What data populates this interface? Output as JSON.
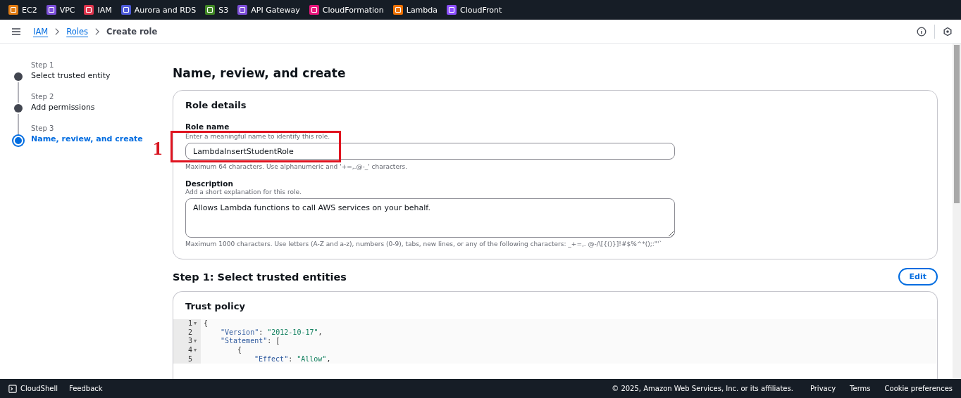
{
  "services": [
    {
      "label": "EC2",
      "color": "#e07b12"
    },
    {
      "label": "VPC",
      "color": "#7b4ed9"
    },
    {
      "label": "IAM",
      "color": "#dd344c"
    },
    {
      "label": "Aurora and RDS",
      "color": "#4d5ad8"
    },
    {
      "label": "S3",
      "color": "#3f8624"
    },
    {
      "label": "API Gateway",
      "color": "#7d4ed9"
    },
    {
      "label": "CloudFormation",
      "color": "#e7157b"
    },
    {
      "label": "Lambda",
      "color": "#ed7100"
    },
    {
      "label": "CloudFront",
      "color": "#8c4fff"
    }
  ],
  "breadcrumbs": [
    {
      "label": "IAM",
      "link": true
    },
    {
      "label": "Roles",
      "link": true
    },
    {
      "label": "Create role",
      "link": false
    }
  ],
  "steps": [
    {
      "step": "Step 1",
      "title": "Select trusted entity",
      "selected": false
    },
    {
      "step": "Step 2",
      "title": "Add permissions",
      "selected": false
    },
    {
      "step": "Step 3",
      "title": "Name, review, and create",
      "selected": true
    }
  ],
  "page_title": "Name, review, and create",
  "role_details": {
    "title": "Role details",
    "role_name": {
      "label": "Role name",
      "hint": "Enter a meaningful name to identify this role.",
      "value": "LambdaInsertStudentRole",
      "constraint": "Maximum 64 characters. Use alphanumeric and '+=,.@-_' characters."
    },
    "description": {
      "label": "Description",
      "hint": "Add a short explanation for this role.",
      "value": "Allows Lambda functions to call AWS services on your behalf.",
      "constraint": "Maximum 1000 characters. Use letters (A-Z and a-z), numbers (0-9), tabs, new lines, or any of the following characters: _+=,. @-/\\[{()}]!#$%^*();:\"'`"
    }
  },
  "annotation": {
    "label": "1"
  },
  "trusted_entities": {
    "title": "Step 1: Select trusted entities",
    "edit_button": "Edit",
    "card_title": "Trust policy",
    "code_lines": [
      {
        "number": "1",
        "fold_marker": "▼",
        "text": "{",
        "children": [
          {
            "number": "2",
            "text": "\"Version\": \"2012-10-17\","
          },
          {
            "number": "3",
            "fold_marker": "▼",
            "text": "\"Statement\": [",
            "children": [
              {
                "number": "4",
                "fold_marker": "▼",
                "text": "{",
                "children": [
                  {
                    "number": "5",
                    "text": "\"Effect\": \"Allow\","
                  }
                ]
              }
            ]
          }
        ]
      }
    ]
  },
  "footer": {
    "left": [
      "CloudShell",
      "Feedback"
    ],
    "copyright": "© 2025, Amazon Web Services, Inc. or its affiliates.",
    "links": [
      "Privacy",
      "Terms",
      "Cookie preferences"
    ]
  }
}
